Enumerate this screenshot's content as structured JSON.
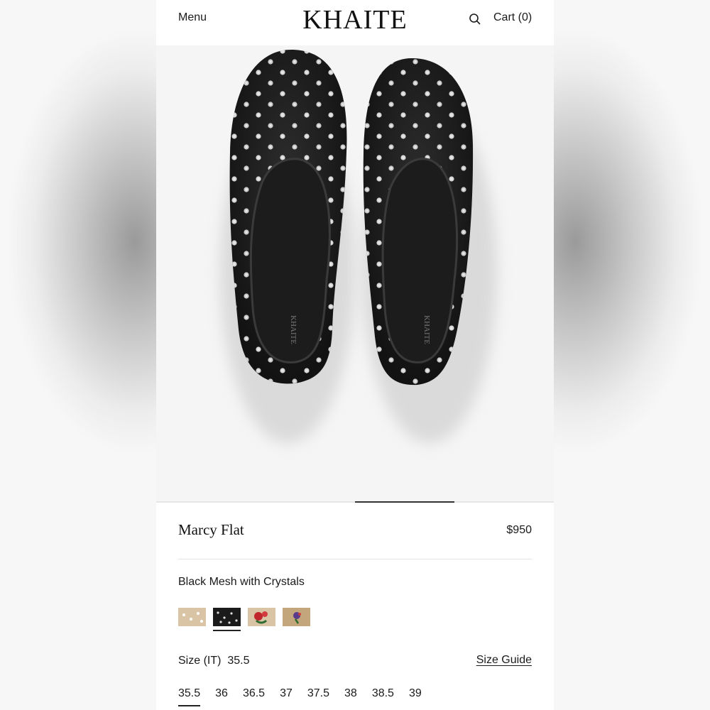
{
  "header": {
    "menu_label": "Menu",
    "logo": "KHAITE",
    "cart_label": "Cart (0)",
    "search_icon": "search-icon"
  },
  "gallery": {
    "image_alt": "Marcy Flat black mesh with crystals, top view",
    "slide_progress": 0.5
  },
  "product": {
    "name": "Marcy Flat",
    "price": "$950",
    "color_name": "Black Mesh with Crystals",
    "swatches": [
      {
        "name": "nude-crystal",
        "color": "#d9c4a6",
        "selected": false
      },
      {
        "name": "black-crystal",
        "color": "#1b1b1b",
        "selected": true
      },
      {
        "name": "nude-rose",
        "color": "#d9c4a6",
        "selected": false
      },
      {
        "name": "tan-violet",
        "color": "#c4a67c",
        "selected": false
      }
    ],
    "size_label": "Size (IT)",
    "selected_size": "35.5",
    "size_guide_label": "Size Guide",
    "sizes": [
      "35.5",
      "36",
      "36.5",
      "37",
      "37.5",
      "38",
      "38.5",
      "39"
    ]
  },
  "colors": {
    "accent": "#222222",
    "image_bg": "#f5f5f5",
    "divider": "#e2e2e2"
  }
}
